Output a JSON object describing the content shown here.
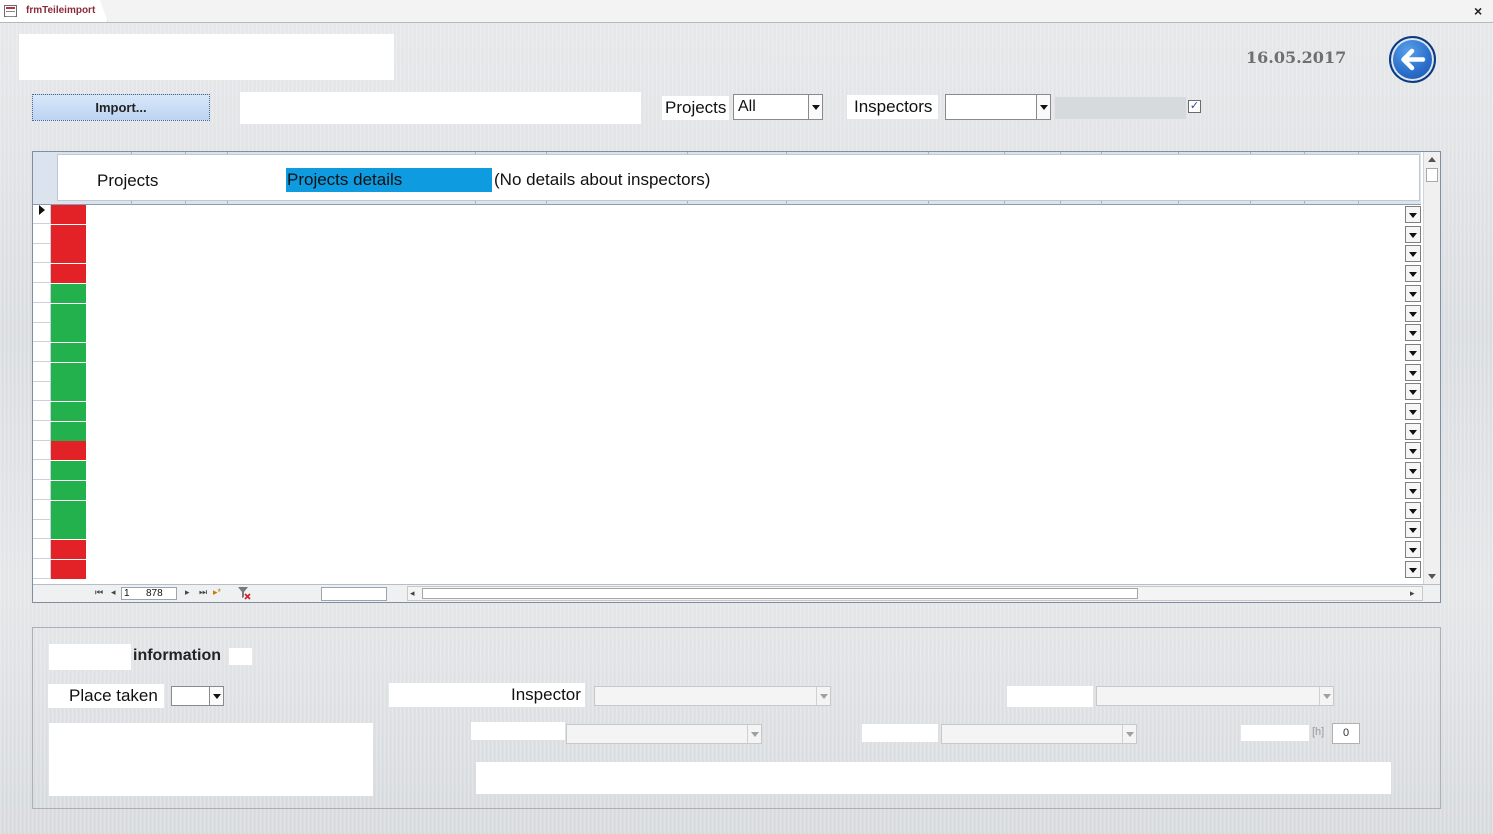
{
  "window": {
    "tab_title": "frmTeileimport",
    "close_glyph": "×"
  },
  "header": {
    "date": "16.05.2017",
    "back_icon": "arrow-left-icon",
    "import_label": "Import..."
  },
  "filters": {
    "projects_label": "Projects",
    "projects_value": "All",
    "inspectors_label": "Inspectors",
    "inspectors_value": "",
    "checkbox_checked": true
  },
  "subform_tabs": [
    {
      "label": "Projects",
      "active": false
    },
    {
      "label": "Projects details",
      "active": true
    },
    {
      "label": "(No details about inspectors)",
      "active": false
    }
  ],
  "grid": {
    "row_status_colors": [
      "#e32227",
      "#e32227",
      "#e32227",
      "#e32227",
      "#22b14c",
      "#22b14c",
      "#22b14c",
      "#22b14c",
      "#22b14c",
      "#22b14c",
      "#22b14c",
      "#22b14c",
      "#e32227",
      "#22b14c",
      "#22b14c",
      "#22b14c",
      "#22b14c",
      "#e32227",
      "#e32227"
    ],
    "colors": {
      "red": "#e32227",
      "green": "#22b14c"
    }
  },
  "navigation": {
    "current_record": "1",
    "total_records": "878",
    "first_icon": "first-record-icon",
    "prev_icon": "prev-record-icon",
    "next_icon": "next-record-icon",
    "last_icon": "last-record-icon",
    "new_icon": "new-record-icon",
    "filter_icon": "no-filter-icon"
  },
  "details": {
    "heading": "information",
    "place_taken_label": "Place taken",
    "inspector_label": "Inspector",
    "hours_unit": "[h]",
    "hours_value": "0"
  }
}
